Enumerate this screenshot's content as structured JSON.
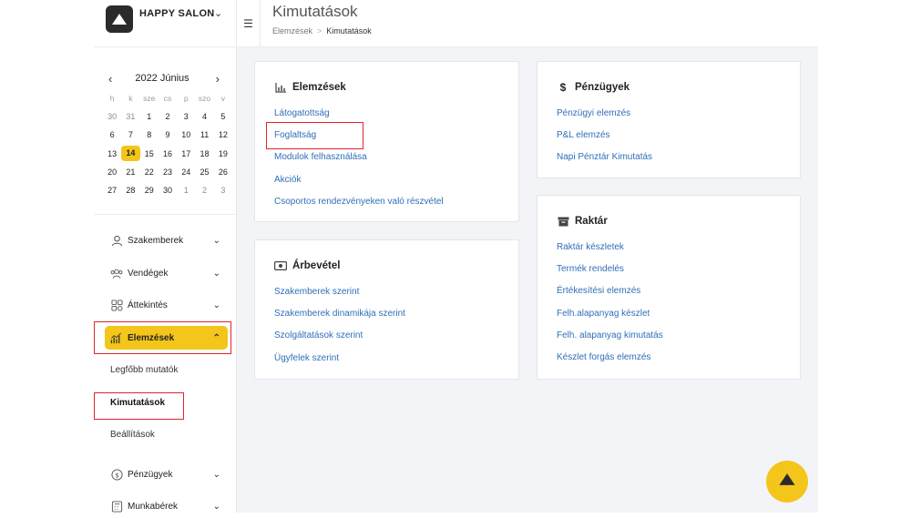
{
  "brand": {
    "name": "HAPPY SALON"
  },
  "calendar": {
    "title": "2022 Június",
    "weekdays": [
      "h",
      "k",
      "sze",
      "cs",
      "p",
      "szo",
      "v"
    ],
    "weeks": [
      [
        "30",
        "31",
        "1",
        "2",
        "3",
        "4",
        "5"
      ],
      [
        "6",
        "7",
        "8",
        "9",
        "10",
        "11",
        "12"
      ],
      [
        "13",
        "14",
        "15",
        "16",
        "17",
        "18",
        "19"
      ],
      [
        "20",
        "21",
        "22",
        "23",
        "24",
        "25",
        "26"
      ],
      [
        "27",
        "28",
        "29",
        "30",
        "1",
        "2",
        "3"
      ]
    ],
    "today": "14"
  },
  "sidebar": {
    "items": [
      {
        "label": "Szakemberek",
        "icon": "user-icon"
      },
      {
        "label": "Vendégek",
        "icon": "users-icon"
      },
      {
        "label": "Áttekintés",
        "icon": "grid-icon"
      },
      {
        "label": "Elemzések",
        "icon": "chart-icon"
      },
      {
        "label": "Pénzügyek",
        "icon": "coin-icon"
      },
      {
        "label": "Munkabérek",
        "icon": "calculator-icon"
      }
    ],
    "sub_items": [
      "Legfőbb mutatók",
      "Kimutatások",
      "Beállítások"
    ]
  },
  "header": {
    "title": "Kimutatások",
    "breadcrumb": [
      "Elemzések",
      "Kimutatások"
    ],
    "breadcrumb_sep": ">"
  },
  "cards": {
    "elemzesek": {
      "title": "Elemzések",
      "links": [
        "Látogatottság",
        "Foglaltság",
        "Modulok felhasználása",
        "Akciók",
        "Csoportos rendezvényeken való részvétel"
      ]
    },
    "arbevetel": {
      "title": "Árbevétel",
      "links": [
        "Szakemberek szerint",
        "Szakemberek dinamikája szerint",
        "Szolgáltatások szerint",
        "Ügyfelek szerint"
      ]
    },
    "penzugyek": {
      "title": "Pénzügyek",
      "links": [
        "Pénzügyi elemzés",
        "P&L elemzés",
        "Napi Pénztár Kimutatás"
      ]
    },
    "raktar": {
      "title": "Raktár",
      "links": [
        "Raktár készletek",
        "Termék rendelés",
        "Értékesítési elemzés",
        "Felh.alapanyag készlet",
        "Felh. alapanyag kimutatás",
        "Készlet forgás elemzés"
      ]
    }
  },
  "colors": {
    "accent": "#f4c51a",
    "link": "#2f6fb7",
    "highlight": "#e0242b"
  }
}
